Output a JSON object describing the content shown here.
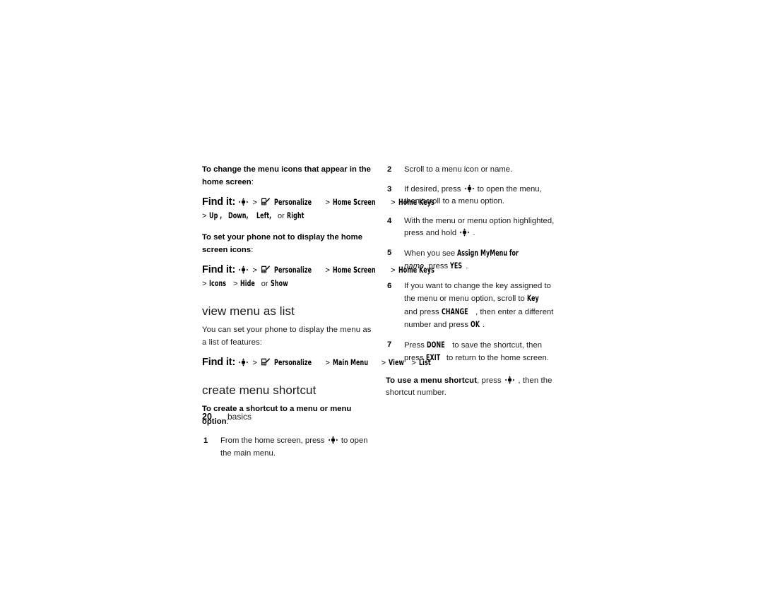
{
  "document": {
    "type": "phone-user-guide-page",
    "page_number": "20",
    "chapter": "basics"
  },
  "icons": {
    "nav_key": "navigation-key-icon",
    "personalize": "personalize-menu-icon"
  },
  "left_column": {
    "block1": {
      "lead_bold": "To change the menu icons that appear in the home screen",
      "lead_colon": ":",
      "findit_label": "Find it:",
      "path_line1": [
        "Personalize",
        "Home Screen",
        "Home Keys"
      ],
      "path_line2_prefix": ">",
      "path_line2": [
        "Up ,",
        "Down,",
        "Left,",
        "Right"
      ],
      "path_line2_or": "or"
    },
    "block2": {
      "lead_bold": "To set your phone not to display the home screen icons",
      "lead_colon": ":",
      "findit_label": "Find it:",
      "path_line1": [
        "Personalize",
        "Home Screen",
        "Home Keys"
      ],
      "path_line2_prefix": ">",
      "path_line2": [
        "Icons",
        "Hide",
        "Show"
      ],
      "path_line2_or": "or"
    },
    "section_view_menu": {
      "heading": "view menu as list",
      "body": "You can set your phone to display the menu as a list of features:",
      "findit_label": "Find it:",
      "path_line1": [
        "Personalize",
        "Main Menu",
        "View",
        "List"
      ]
    },
    "section_create_shortcut": {
      "heading": "create menu shortcut",
      "lead_bold": "To create a shortcut to a menu or menu option",
      "lead_colon": ":",
      "step1": {
        "num": "1",
        "text_before": "From the home screen, press",
        "text_after": "to open the main menu."
      }
    }
  },
  "right_column": {
    "step2": {
      "num": "2",
      "text": "Scroll to a menu icon or name."
    },
    "step3": {
      "num": "3",
      "text_before": "If desired, press",
      "text_after": "to open the menu, then scroll to a menu option."
    },
    "step4": {
      "num": "4",
      "text_before": "With the menu or menu option highlighted, press and hold",
      "text_after": "."
    },
    "step5": {
      "num": "5",
      "text_before": "When you see",
      "display_text": "Assign MyMenu for",
      "italic_text": "name,",
      "text_mid": "press",
      "key_label": "YES",
      "text_after": "."
    },
    "step6": {
      "num": "6",
      "text_a": "If you want to change the key assigned to the menu or menu option, scroll to",
      "key_a": "Key",
      "text_b": "and press",
      "key_b": "CHANGE",
      "text_c": ", then enter a different number and press",
      "key_c": "OK",
      "text_d": "."
    },
    "step7": {
      "num": "7",
      "text_a": "Press",
      "key_a": "DONE",
      "text_b": "to save the shortcut, then press",
      "key_b": "EXIT",
      "text_c": "to return to the home screen."
    },
    "closing": {
      "lead_bold": "To use a menu shortcut",
      "text_before": ", press",
      "text_after": ", then the shortcut number."
    }
  },
  "colors": {
    "text": "#1a1a1a",
    "heading": "#1a1a1a",
    "background": "#ffffff"
  }
}
